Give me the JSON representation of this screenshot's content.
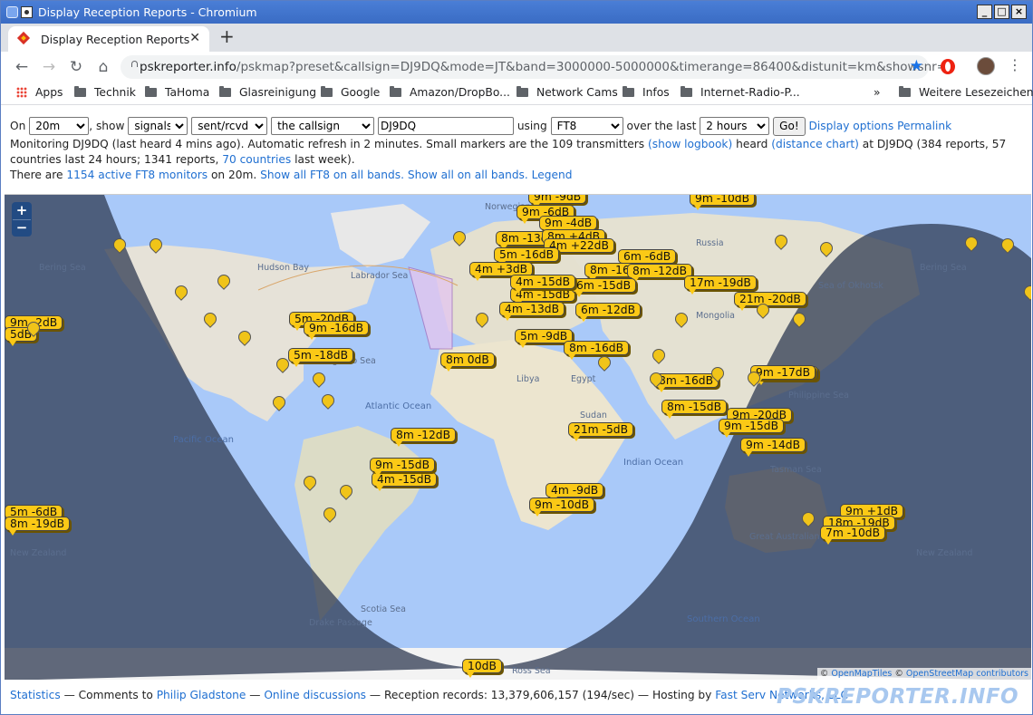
{
  "window": {
    "title": "Display Reception Reports - Chromium"
  },
  "tab": {
    "label": "Display Reception Reports",
    "close": "✕",
    "new_tab": "+"
  },
  "toolbar": {
    "url_host": "pskreporter.info",
    "url_path": "/pskmap?preset&callsign=DJ9DQ&mode=JT&band=3000000-5000000&timerange=86400&distunit=km&showsnr=1"
  },
  "bookmarks": {
    "items": [
      {
        "label": "Apps",
        "icon": "apps-icon"
      },
      {
        "label": "Technik",
        "icon": "folder-icon"
      },
      {
        "label": "TaHoma",
        "icon": "folder-icon"
      },
      {
        "label": "Glasreinigung",
        "icon": "folder-icon"
      },
      {
        "label": "Google",
        "icon": "folder-icon"
      },
      {
        "label": "Amazon/DropBo...",
        "icon": "folder-icon"
      },
      {
        "label": "Network Cams",
        "icon": "folder-icon"
      },
      {
        "label": "Infos",
        "icon": "folder-icon"
      },
      {
        "label": "Internet-Radio-P...",
        "icon": "folder-icon"
      }
    ],
    "overflow": "»",
    "other_label": "Weitere Lesezeichen"
  },
  "controls": {
    "on_label": "On",
    "band": "20m",
    "show_label": ", show",
    "show_value": "signals",
    "direction": "sent/rcvd by",
    "who": "the callsign",
    "callsign": "DJ9DQ",
    "using_label": "using",
    "mode": "FT8",
    "over_label": "over the last",
    "range": "2 hours",
    "go": "Go!",
    "display_options": "Display options",
    "permalink": "Permalink",
    "monitor_text": "Monitoring DJ9DQ (last heard 4 mins ago). Automatic refresh in 2 minutes. Small markers are the 109 transmitters",
    "show_logbook": "(show logbook)",
    "heard_label": "heard",
    "distance_chart": "(distance chart)",
    "at_text": "at DJ9DQ (384 reports, 57 countries last 24 hours; 1341 reports,",
    "countries_link": "70 countries",
    "last_week": "last week).",
    "there_are": "There are",
    "active_link": "1154 active FT8 monitors",
    "on_20m": "on 20m.",
    "show_ft8_all": "Show all FT8 on all bands.",
    "show_all": "Show all on all bands.",
    "legend": "Legend"
  },
  "map": {
    "zoom_in": "+",
    "zoom_out": "−",
    "attribution_copy1": "©",
    "attribution_tiles": "OpenMapTiles",
    "attribution_copy2": "©",
    "attribution_osm": "OpenStreetMap contributors",
    "place_labels": [
      "Hudson Bay",
      "Labrador Sea",
      "Sargasso Sea",
      "Norwegian Sea",
      "Russia",
      "Sea of Okhotsk",
      "Bering Sea",
      "Bering Sea",
      "Libya",
      "Egypt",
      "Sudan",
      "Mongolia",
      "Philippine Sea",
      "Tasman Sea",
      "Great Australian Bight",
      "New Zealand",
      "New Zealand",
      "Scotia Sea",
      "Drake Passage",
      "Ross Sea"
    ],
    "ocean_labels": [
      "Atlantic Ocean",
      "Pacific Ocean",
      "Indian Ocean",
      "Southern Ocean"
    ],
    "spots": [
      "9m -9dB",
      "9m -10dB",
      "9m -6dB",
      "9m -4dB",
      "8m -13dB",
      "8m +4dB",
      "4m +22dB",
      "5m -16dB",
      "4m +3dB",
      "6m -6dB",
      "8m -16dB",
      "8m -12dB",
      "4m -15dB",
      "6m -15dB",
      "17m -19dB",
      "4m -15dB",
      "21m -20dB",
      "4m -13dB",
      "6m -12dB",
      "5m -9dB",
      "8m -16dB",
      "8m 0dB",
      "9m -15dB",
      "4m -15dB",
      "5m -20dB",
      "9m -16dB",
      "5m -18dB",
      "9m -17dB",
      "8m -16dB",
      "8m -15dB",
      "8m -12dB",
      "21m -5dB",
      "9m -20dB",
      "9m -15dB",
      "9m -14dB",
      "9m -15dB",
      "4m -9dB",
      "9m -10dB",
      "9m +1dB",
      "18m -19dB",
      "7m -10dB",
      "5m -6dB",
      "8m -19dB",
      "10dB",
      "9m -2dB",
      "5dB",
      "6dB"
    ]
  },
  "footer": {
    "statistics": "Statistics",
    "comments": "— Comments to",
    "author": "Philip Gladstone",
    "sep1": "—",
    "online": "Online discussions",
    "records": "— Reception records: 13,379,606,157 (194/sec) — Hosting by",
    "host": "Fast Serv Networks, LLC",
    "brand": "PSKREPORTER.INFO"
  },
  "colors": {
    "spot": "#fbc916",
    "water": "#a9c9f9",
    "night": "#3d4a63",
    "link": "#1f6fd1",
    "titlebar": "#3a6cc4"
  }
}
